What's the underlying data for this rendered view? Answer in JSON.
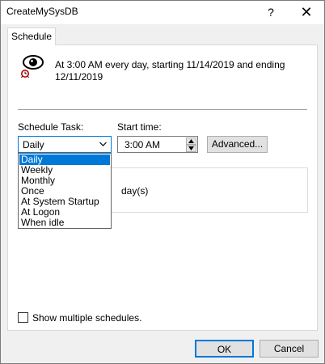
{
  "window": {
    "title": "CreateMySysDB",
    "help_glyph": "?",
    "close_glyph": "✕"
  },
  "tabs": [
    {
      "label": "Schedule",
      "active": true
    }
  ],
  "summary": {
    "icon": "eye-icon",
    "text": "At 3:00 AM every day, starting 11/14/2019 and ending 12/11/2019"
  },
  "schedule_task": {
    "label": "Schedule Task:",
    "value": "Daily",
    "options": [
      "Daily",
      "Weekly",
      "Monthly",
      "Once",
      "At System Startup",
      "At Logon",
      "When idle"
    ],
    "selected_index": 0
  },
  "start_time": {
    "label": "Start time:",
    "value": "3:00 AM"
  },
  "advanced_button": "Advanced...",
  "schedule_group": {
    "unit_text": "day(s)"
  },
  "multiple_schedules": {
    "label": "Show multiple schedules.",
    "checked": false
  },
  "footer": {
    "ok_label": "OK",
    "cancel_label": "Cancel"
  },
  "colors": {
    "accent": "#0078d7",
    "dialog_bg": "#f0f0f0",
    "button_bg": "#e1e1e1"
  }
}
